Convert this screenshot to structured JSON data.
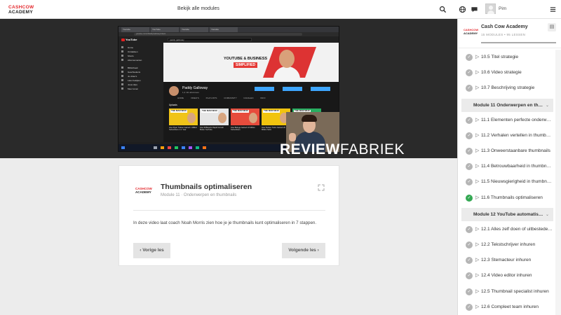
{
  "header": {
    "logo_line1": "CASHCOW",
    "logo_line2": "ACADEMY",
    "all_modules_label": "Bekijk alle modules",
    "username": "Pim"
  },
  "video": {
    "watermark_bold": "REVIEW",
    "watermark_light": "FABRIEK",
    "screenshot": {
      "browser_tabs": [
        "Youtube",
        "YouTube",
        "Youtube",
        "Youtube"
      ],
      "url": "youtube.com/c/PaddyGalloway/videos",
      "yt_search": "paddy galloway",
      "banner_line1": "YOUTUBE & BUSINESS",
      "banner_line2": "SIMPLIFIED",
      "channel_name": "Paddy Galloway",
      "channel_subs": "1,2 mln abonnees",
      "channel_tabs": "HOME VIDEO'S PLAYLISTS COMMUNITY KANALEN INFO",
      "grid_label": "Uploads",
      "sidebar_items": [
        "Home",
        "Ontdekken",
        "Shorts",
        "Abonnementen",
        "Bibliotheek",
        "Geschiedenis",
        "Je video's",
        "Later bekijken",
        "Jouw clips",
        "Meer tonen"
      ],
      "videos": [
        {
          "thumb_text": "THE MAN WHO",
          "caption": "How Ryan Trahan Gained 1 Million Subscribers in 1 Year"
        },
        {
          "thumb_text": "THE MAN WHO",
          "caption": "How MrBeast's Rapid Growth Broke YouTube"
        },
        {
          "thumb_text": "THE MAN WHO",
          "caption": "How Beluga Gained 10 Million Subscribers"
        },
        {
          "thumb_text": "THE MAN WHO",
          "caption": "How Stokes Twins Gained 20 Million Subs"
        },
        {
          "thumb_text": "THE MAN WHO",
          "caption": "How Airrack Grew So Fast"
        }
      ]
    }
  },
  "lesson": {
    "logo_line1": "CASHCOW",
    "logo_line2": "ACADEMY",
    "title": "Thumbnails optimaliseren",
    "subtitle": "Module 11 · Onderwerpen en thumbnails",
    "description": "In deze video laat coach Noah Morris zien hoe je je thumbnails kunt optimaliseren in 7 stappen.",
    "prev_label": "Vorige les",
    "next_label": "Volgende les"
  },
  "sidebar": {
    "logo_line1": "CASHCOW",
    "logo_line2": "ACADEMY",
    "title": "Cash Cow Academy",
    "meta": "15 MODULES • 95 LESSEN",
    "progress": 1.0,
    "items": [
      {
        "kind": "lesson",
        "text": "10.5 Titel strategie",
        "done": false
      },
      {
        "kind": "lesson",
        "text": "10.6 Video strategie",
        "done": false
      },
      {
        "kind": "lesson",
        "text": "10.7 Beschrijving strategie",
        "done": false
      },
      {
        "kind": "module",
        "text": "Module 11   Onderwerpen en thumbnails"
      },
      {
        "kind": "lesson",
        "text": "11.1 Elementen perfecte onderwerpen",
        "done": false
      },
      {
        "kind": "lesson",
        "text": "11.2 Verhalen vertellen in thumbnails",
        "done": false
      },
      {
        "kind": "lesson",
        "text": "11.3 Onweerstaanbare thumbnails",
        "done": false
      },
      {
        "kind": "lesson",
        "text": "11.4 Betrouwbaarheid in thumbnails",
        "done": false
      },
      {
        "kind": "lesson",
        "text": "11.5 Nieuwsgierigheid in thumbnails",
        "done": false
      },
      {
        "kind": "lesson",
        "text": "11.6 Thumbnails optimaliseren",
        "done": true
      },
      {
        "kind": "module",
        "text": "Module 12   YouTube automatisatie"
      },
      {
        "kind": "lesson",
        "text": "12.1 Alles zelf doen of uitbesteden?",
        "done": false
      },
      {
        "kind": "lesson",
        "text": "12.2 Tekstschrijver inhuren",
        "done": false
      },
      {
        "kind": "lesson",
        "text": "12.3 Stemacteur inhuren",
        "done": false
      },
      {
        "kind": "lesson",
        "text": "12.4 Video editor inhuren",
        "done": false
      },
      {
        "kind": "lesson",
        "text": "12.5 Thumbnail specialist inhuren",
        "done": false
      },
      {
        "kind": "lesson",
        "text": "12.6 Compleet team inhuren",
        "done": false
      }
    ]
  },
  "icons": {
    "search": "search-icon",
    "globe": "globe-icon",
    "chat": "chat-icon",
    "menu": "hamburger-menu-icon",
    "expand": "expand-icon",
    "check": "check-icon",
    "play": "play-icon",
    "chevron_down": "chevron-down-icon",
    "toggle": "sidebar-toggle-icon"
  },
  "colors": {
    "brand_red": "#e3262b",
    "done_green": "#34a853",
    "pending_gray": "#b5b5b5"
  }
}
